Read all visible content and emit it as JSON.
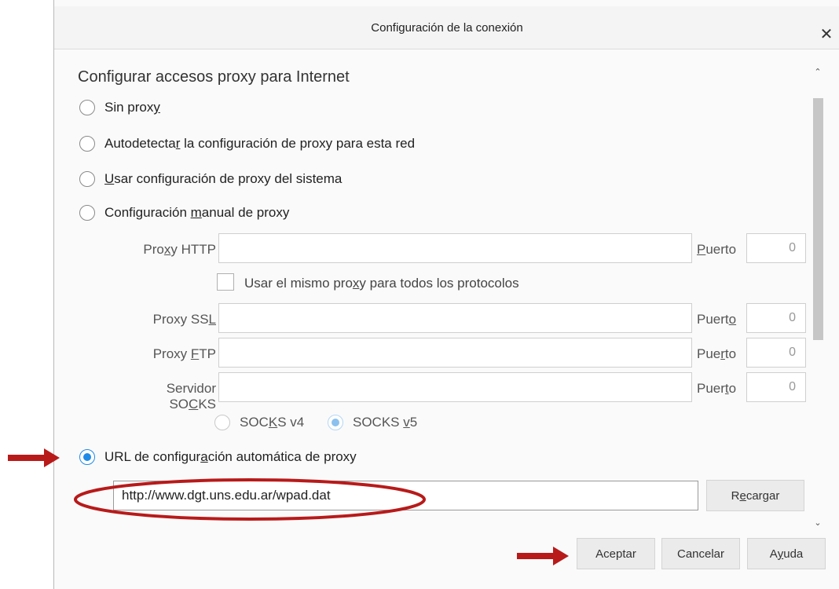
{
  "window": {
    "title": "Configuración de la conexión",
    "close_label": "✕"
  },
  "section_title": "Configurar accesos proxy para Internet",
  "options": {
    "no_proxy": {
      "pre": "Sin prox",
      "u": "y",
      "post": ""
    },
    "autodetect": {
      "pre": "Autodetecta",
      "u": "r",
      "post": " la configuración de proxy para esta red"
    },
    "system": {
      "pre": "",
      "u": "U",
      "post": "sar configuración de proxy del sistema"
    },
    "manual": {
      "pre": "Configuración ",
      "u": "m",
      "post": "anual de proxy"
    },
    "auto_url": {
      "pre": "URL de configur",
      "u": "a",
      "post": "ción automática de proxy"
    }
  },
  "selected_option": "auto_url",
  "manual": {
    "http_label": {
      "pre": "Pro",
      "u": "x",
      "post": "y HTTP"
    },
    "same_proxy_label": {
      "pre": "Usar el mismo pro",
      "u": "x",
      "post": "y para todos los protocolos"
    },
    "ssl_label": {
      "pre": "Proxy SS",
      "u": "L",
      "post": ""
    },
    "ftp_label": {
      "pre": "Proxy ",
      "u": "F",
      "post": "TP"
    },
    "socks_label": {
      "pre": "Servidor SO",
      "u": "C",
      "post": "KS"
    },
    "port_label_http": {
      "pre": "",
      "u": "P",
      "post": "uerto"
    },
    "port_label_ssl": {
      "pre": "Puert",
      "u": "o",
      "post": ""
    },
    "port_label_ftp": {
      "pre": "Pue",
      "u": "r",
      "post": "to"
    },
    "port_label_socks": {
      "pre": "Puer",
      "u": "t",
      "post": "o"
    },
    "http_value": "",
    "ssl_value": "",
    "ftp_value": "",
    "socks_value": "",
    "http_port": "0",
    "ssl_port": "0",
    "ftp_port": "0",
    "socks_port": "0",
    "socks_v4": {
      "pre": "SOC",
      "u": "K",
      "post": "S v4"
    },
    "socks_v5": {
      "pre": "SOCKS ",
      "u": "v",
      "post": "5"
    },
    "socks_selected": "v5"
  },
  "auto_url_value": "http://www.dgt.uns.edu.ar/wpad.dat",
  "reload_button": {
    "pre": "R",
    "u": "e",
    "post": "cargar"
  },
  "buttons": {
    "ok": "Aceptar",
    "cancel": "Cancelar",
    "help": {
      "pre": "A",
      "u": "y",
      "post": "uda"
    }
  },
  "colors": {
    "accent": "#1e8ae8",
    "annotation": "#b81a1a"
  },
  "icons": {
    "close": "close-icon",
    "scroll_up": "chevron-up-icon",
    "scroll_down": "chevron-down-icon"
  }
}
